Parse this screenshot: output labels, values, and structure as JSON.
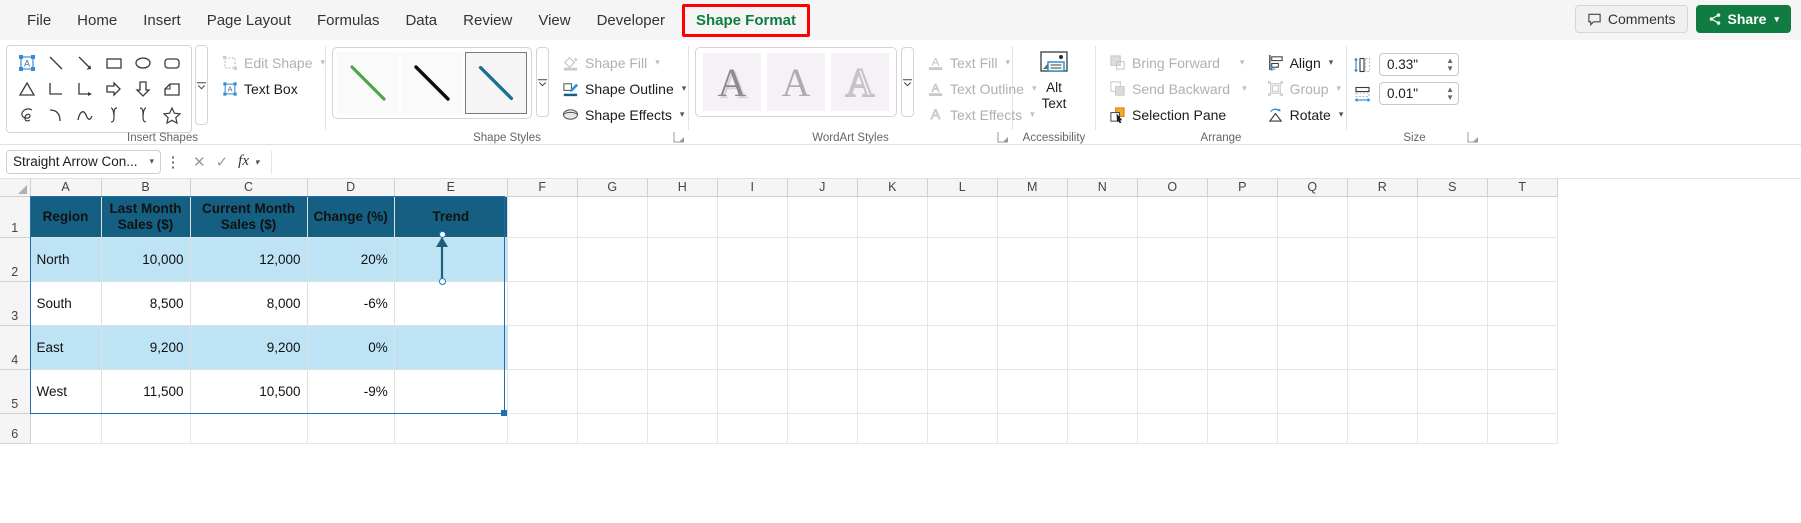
{
  "tabs": [
    {
      "label": "File",
      "active": false
    },
    {
      "label": "Home",
      "active": false
    },
    {
      "label": "Insert",
      "active": false
    },
    {
      "label": "Page Layout",
      "active": false
    },
    {
      "label": "Formulas",
      "active": false
    },
    {
      "label": "Data",
      "active": false
    },
    {
      "label": "Review",
      "active": false
    },
    {
      "label": "View",
      "active": false
    },
    {
      "label": "Developer",
      "active": false
    },
    {
      "label": "Shape Format",
      "active": true,
      "highlight_color": "#ff0000",
      "text_color": "#107c41"
    }
  ],
  "titlebar": {
    "comments_label": "Comments",
    "comments_icon": "comment-icon",
    "share_label": "Share",
    "share_icon": "share-icon",
    "share_color": "#107c41",
    "share_chevron": "chevron-down-icon"
  },
  "ribbon": {
    "groups": [
      {
        "name": "insert-shapes",
        "label": "Insert Shapes",
        "shapes": [
          "textbox-shape-icon",
          "line-icon",
          "line-arrow-icon",
          "rectangle-icon",
          "oval-icon",
          "rounded-rectangle-icon",
          "triangle-icon",
          "elbow-connector-icon",
          "elbow-arrow-connector-icon",
          "right-arrow-icon",
          "down-arrow-icon",
          "folded-corner-icon",
          "scribble-icon",
          "arc-icon",
          "curve-icon",
          "left-brace-icon",
          "right-brace-icon",
          "star-icon"
        ],
        "more_icon": "gallery-more-icon",
        "commands": [
          {
            "label": "Edit Shape",
            "icon": "edit-shape-icon",
            "disabled": true,
            "chevron": true
          },
          {
            "label": "Text Box",
            "icon": "text-box-icon",
            "disabled": false,
            "chevron": false
          }
        ]
      },
      {
        "name": "shape-styles",
        "label": "Shape Styles",
        "thumbs": [
          {
            "name": "line-style-green",
            "color": "#4ca64c",
            "selected": false
          },
          {
            "name": "line-style-black",
            "color": "#0d0d0d",
            "selected": false
          },
          {
            "name": "line-style-blue",
            "color": "#1f6f94",
            "selected": true
          }
        ],
        "more_icon": "gallery-more-icon",
        "commands": [
          {
            "label": "Shape Fill",
            "icon": "shape-fill-icon",
            "disabled": true,
            "chevron": true
          },
          {
            "label": "Shape Outline",
            "icon": "shape-outline-icon",
            "disabled": false,
            "chevron": true
          },
          {
            "label": "Shape Effects",
            "icon": "shape-effects-icon",
            "disabled": false,
            "chevron": true
          }
        ],
        "launcher": true
      },
      {
        "name": "wordart-styles",
        "label": "WordArt Styles",
        "thumbs": [
          {
            "name": "wordart-style-shadow",
            "glyph": "A"
          },
          {
            "name": "wordart-style-fill",
            "glyph": "A"
          },
          {
            "name": "wordart-style-outline",
            "glyph": "A"
          }
        ],
        "more_icon": "gallery-more-icon",
        "commands": [
          {
            "label": "Text Fill",
            "icon": "text-fill-icon",
            "disabled": true,
            "chevron": true
          },
          {
            "label": "Text Outline",
            "icon": "text-outline-icon",
            "disabled": true,
            "chevron": true
          },
          {
            "label": "Text Effects",
            "icon": "text-effects-icon",
            "disabled": true,
            "chevron": true
          }
        ],
        "launcher": true
      },
      {
        "name": "accessibility",
        "label": "Accessibility",
        "button": {
          "label_line1": "Alt",
          "label_line2": "Text",
          "icon": "alt-text-icon"
        }
      },
      {
        "name": "arrange",
        "label": "Arrange",
        "commands_left": [
          {
            "label": "Bring Forward",
            "icon": "bring-forward-icon",
            "disabled": true,
            "chevron": true
          },
          {
            "label": "Send Backward",
            "icon": "send-backward-icon",
            "disabled": true,
            "chevron": true
          },
          {
            "label": "Selection Pane",
            "icon": "selection-pane-icon",
            "disabled": false,
            "chevron": false
          }
        ],
        "commands_right": [
          {
            "label": "Align",
            "icon": "align-icon",
            "disabled": false,
            "chevron": true
          },
          {
            "label": "Group",
            "icon": "group-icon",
            "disabled": true,
            "chevron": true
          },
          {
            "label": "Rotate",
            "icon": "rotate-icon",
            "disabled": false,
            "chevron": true
          }
        ]
      },
      {
        "name": "size",
        "label": "Size",
        "height": {
          "icon": "shape-height-icon",
          "value": "0.33\""
        },
        "width": {
          "icon": "shape-width-icon",
          "value": "0.01\""
        },
        "launcher": true
      }
    ]
  },
  "formula_bar": {
    "name_box_value": "Straight Arrow Con...",
    "name_box_chevron": "chevron-down-icon",
    "kebab_icon": "more-options-icon",
    "cancel_icon": "cancel-icon",
    "confirm_icon": "confirm-icon",
    "fx_icon": "insert-function-icon",
    "formula_value": ""
  },
  "sheet": {
    "columns": [
      "A",
      "B",
      "C",
      "D",
      "E",
      "F",
      "G",
      "H",
      "I",
      "J",
      "K",
      "L",
      "M",
      "N",
      "O",
      "P",
      "Q",
      "R",
      "S",
      "T"
    ],
    "rows": [
      "1",
      "2",
      "3",
      "4",
      "5",
      "6"
    ],
    "header_bg": "#156082",
    "band_bg": "#bee3f4",
    "table": {
      "headers": [
        {
          "line1": "Region",
          "line2": ""
        },
        {
          "line1": "Last Month",
          "line2": "Sales ($)"
        },
        {
          "line1": "Current Month",
          "line2": "Sales ($)"
        },
        {
          "line1": "Change (%)",
          "line2": ""
        },
        {
          "line1": "Trend",
          "line2": ""
        }
      ],
      "rows": [
        {
          "region": "North",
          "last_month": "10,000",
          "current_month": "12,000",
          "change": "20%",
          "trend": "",
          "banded": true
        },
        {
          "region": "South",
          "last_month": "8,500",
          "current_month": "8,000",
          "change": "-6%",
          "trend": "",
          "banded": false
        },
        {
          "region": "East",
          "last_month": "9,200",
          "current_month": "9,200",
          "change": "0%",
          "trend": "",
          "banded": true
        },
        {
          "region": "West",
          "last_month": "11,500",
          "current_month": "10,500",
          "change": "-9%",
          "trend": "",
          "banded": false
        }
      ]
    },
    "shape": {
      "name": "straight-arrow-connector",
      "color": "#1f5f7a",
      "cell": "E2",
      "selected": true
    }
  }
}
